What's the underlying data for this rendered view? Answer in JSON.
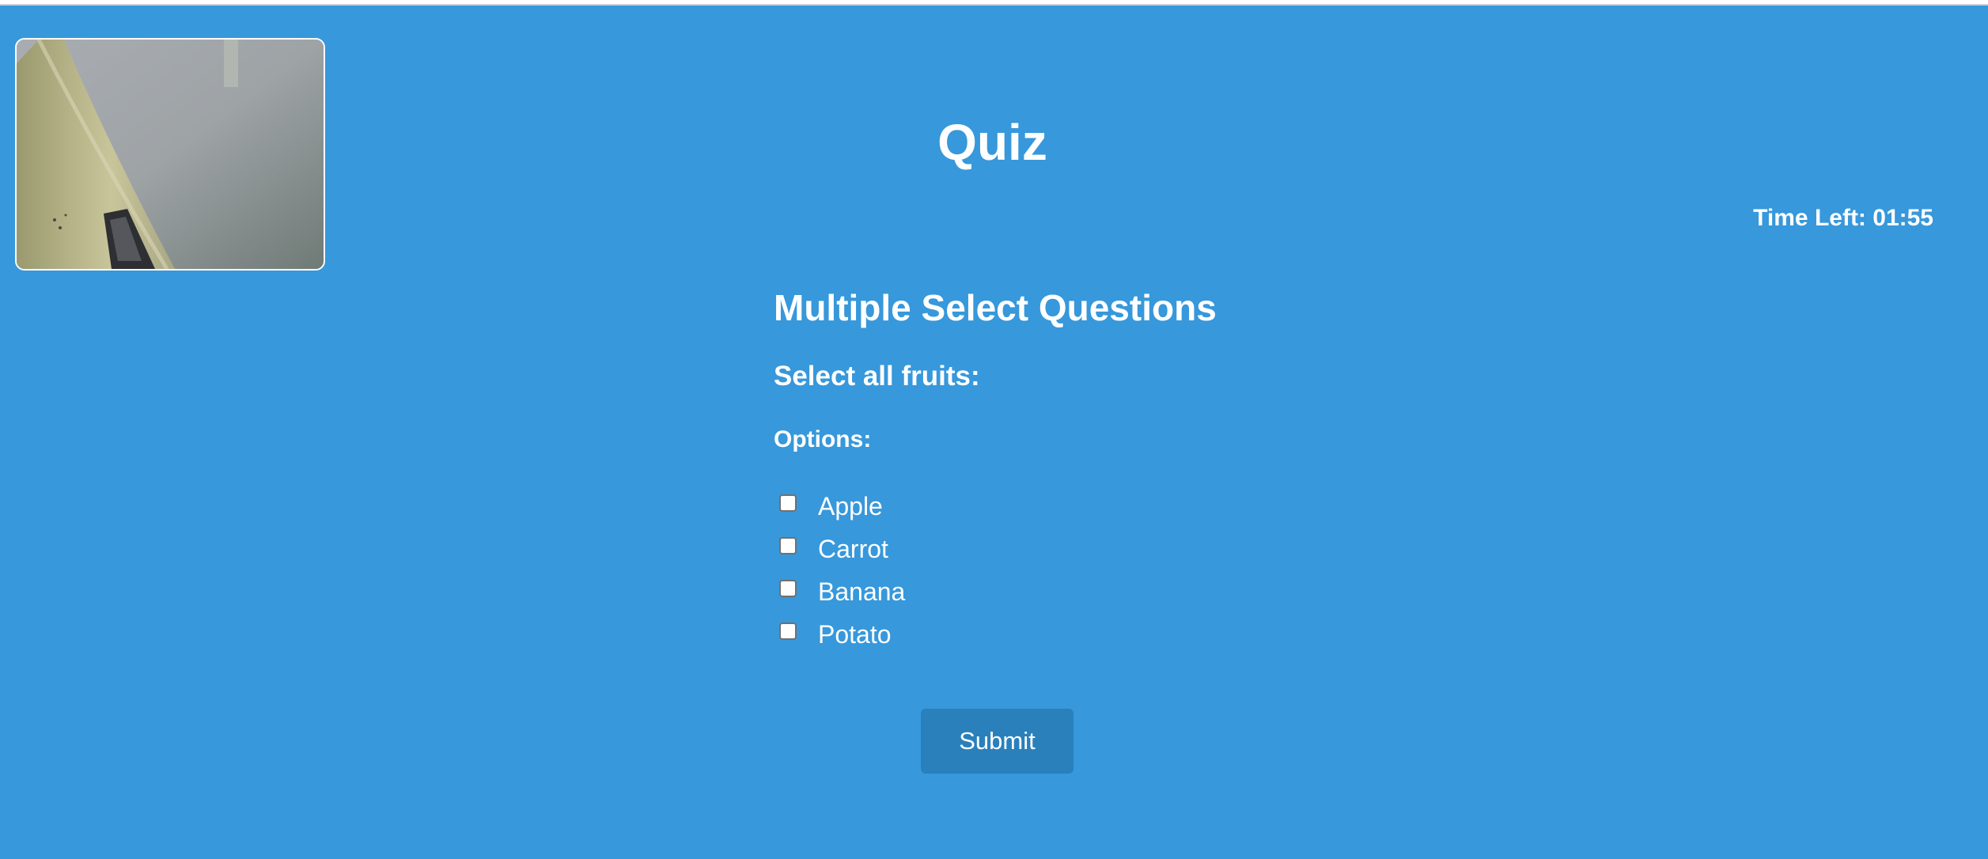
{
  "page": {
    "title": "Quiz",
    "background_color": "#3798db"
  },
  "timer": {
    "label": "Time Left:",
    "value": "01:55"
  },
  "quiz": {
    "section_title": "Multiple Select Questions",
    "question": "Select all fruits:",
    "options_label": "Options:",
    "options": [
      {
        "label": "Apple",
        "checked": false
      },
      {
        "label": "Carrot",
        "checked": false
      },
      {
        "label": "Banana",
        "checked": false
      },
      {
        "label": "Potato",
        "checked": false
      }
    ]
  },
  "submit": {
    "label": "Submit",
    "color": "#2a80bb"
  },
  "webcam": {
    "icon": "webcam-feed"
  }
}
